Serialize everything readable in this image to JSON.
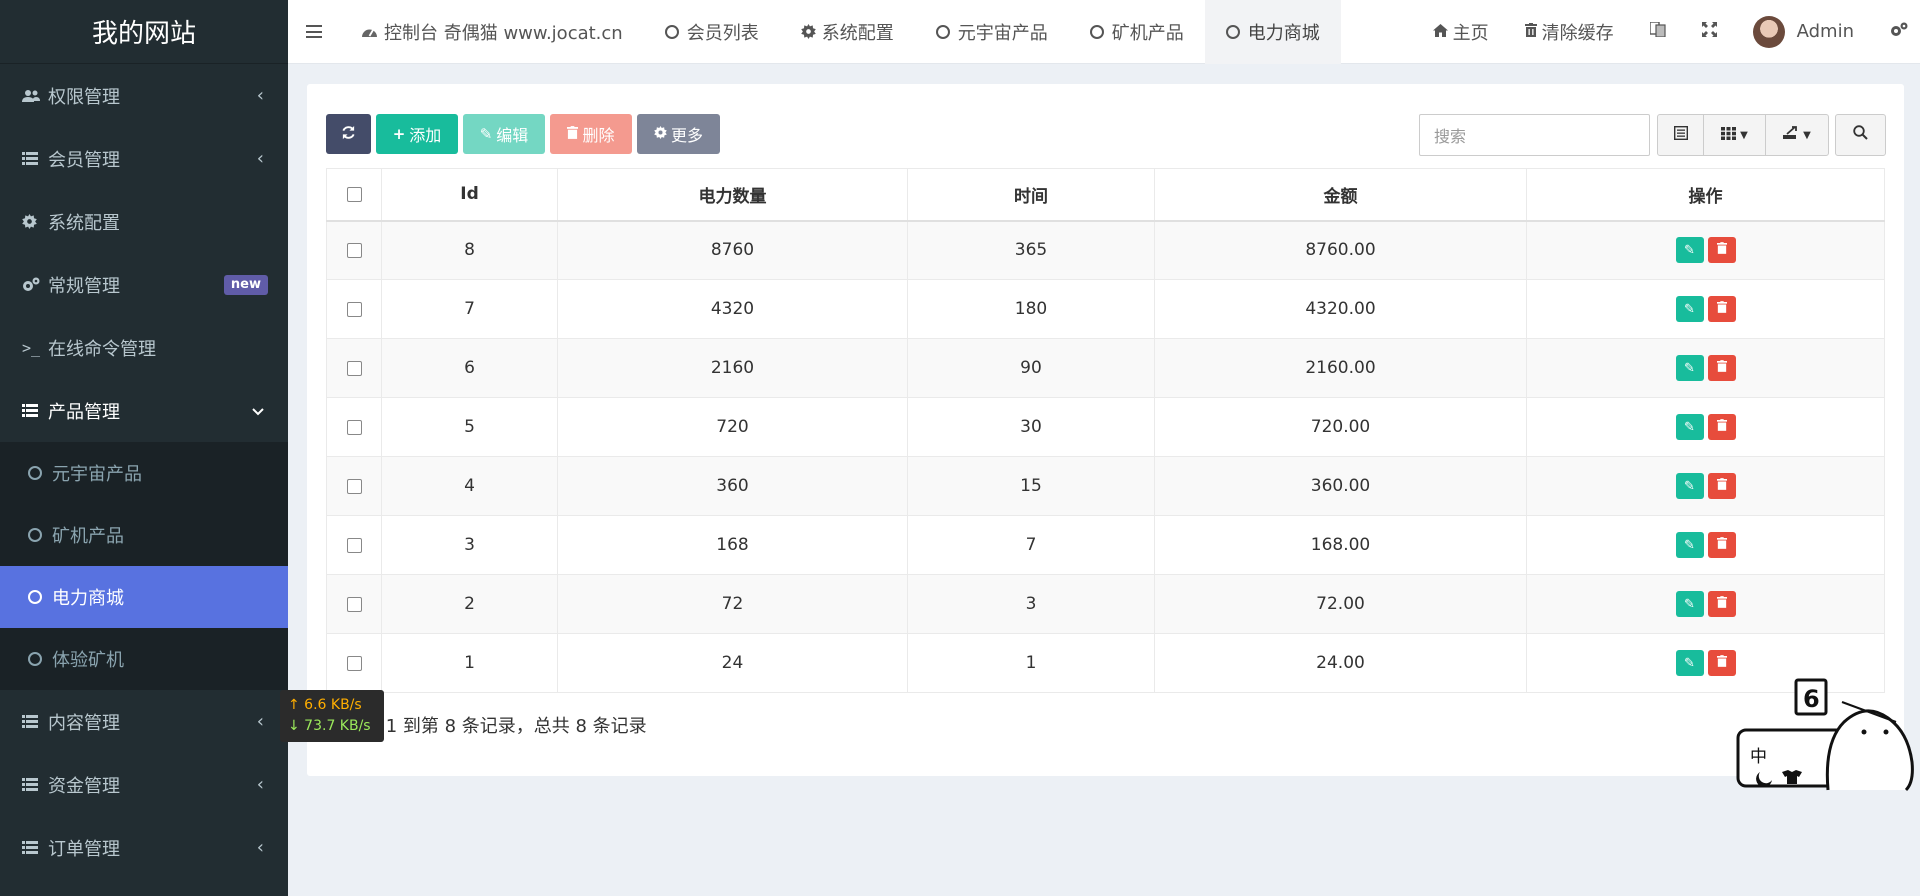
{
  "site_title": "我的网站",
  "sidebar": {
    "items": [
      {
        "label": "权限管理",
        "icon": "users-icon",
        "arrow": "‹"
      },
      {
        "label": "会员管理",
        "icon": "list-icon",
        "arrow": "‹"
      },
      {
        "label": "系统配置",
        "icon": "gear-icon",
        "arrow": ""
      },
      {
        "label": "常规管理",
        "icon": "gears-icon",
        "badge": "new"
      },
      {
        "label": "在线命令管理",
        "icon": "terminal-icon",
        "arrow": ""
      },
      {
        "label": "产品管理",
        "icon": "list-icon",
        "arrow": "⌄"
      }
    ],
    "submenu": [
      {
        "label": "元宇宙产品"
      },
      {
        "label": "矿机产品"
      },
      {
        "label": "电力商城"
      },
      {
        "label": "体验矿机"
      }
    ],
    "items_after": [
      {
        "label": "内容管理",
        "arrow": "‹"
      },
      {
        "label": "资金管理",
        "arrow": "‹"
      },
      {
        "label": "订单管理",
        "arrow": "‹"
      }
    ]
  },
  "topbar": {
    "tabs": [
      {
        "label": "控制台 奇偶猫 www.jocat.cn",
        "icon": "dashboard-icon"
      },
      {
        "label": "会员列表"
      },
      {
        "label": "系统配置",
        "icon": "gear-icon"
      },
      {
        "label": "元宇宙产品"
      },
      {
        "label": "矿机产品"
      },
      {
        "label": "电力商城"
      }
    ],
    "home_label": "主页",
    "clear_cache_label": "清除缓存",
    "user_name": "Admin"
  },
  "toolbar": {
    "add_label": "添加",
    "edit_label": "编辑",
    "delete_label": "删除",
    "more_label": "更多",
    "search_placeholder": "搜索"
  },
  "table": {
    "headers": [
      "Id",
      "电力数量",
      "时间",
      "金额",
      "操作"
    ],
    "rows": [
      {
        "id": "8",
        "power": "8760",
        "time": "365",
        "amount": "8760.00"
      },
      {
        "id": "7",
        "power": "4320",
        "time": "180",
        "amount": "4320.00"
      },
      {
        "id": "6",
        "power": "2160",
        "time": "90",
        "amount": "2160.00"
      },
      {
        "id": "5",
        "power": "720",
        "time": "30",
        "amount": "720.00"
      },
      {
        "id": "4",
        "power": "360",
        "time": "15",
        "amount": "360.00"
      },
      {
        "id": "3",
        "power": "168",
        "time": "7",
        "amount": "168.00"
      },
      {
        "id": "2",
        "power": "72",
        "time": "3",
        "amount": "72.00"
      },
      {
        "id": "1",
        "power": "24",
        "time": "1",
        "amount": "24.00"
      }
    ]
  },
  "pager_text": "显示第 1 到第 8 条记录，总共 8 条记录",
  "netspeed": {
    "up": "↑ 6.6 KB/s",
    "down": "↓ 73.7 KB/s"
  },
  "mascot_text": "中",
  "mascot_badge": "6",
  "colors": {
    "sidebar_bg": "#222d32",
    "active_item": "#5872e0",
    "add_green": "#18bc9c",
    "delete_red": "#e74c3c",
    "refresh_dark": "#444c69"
  }
}
